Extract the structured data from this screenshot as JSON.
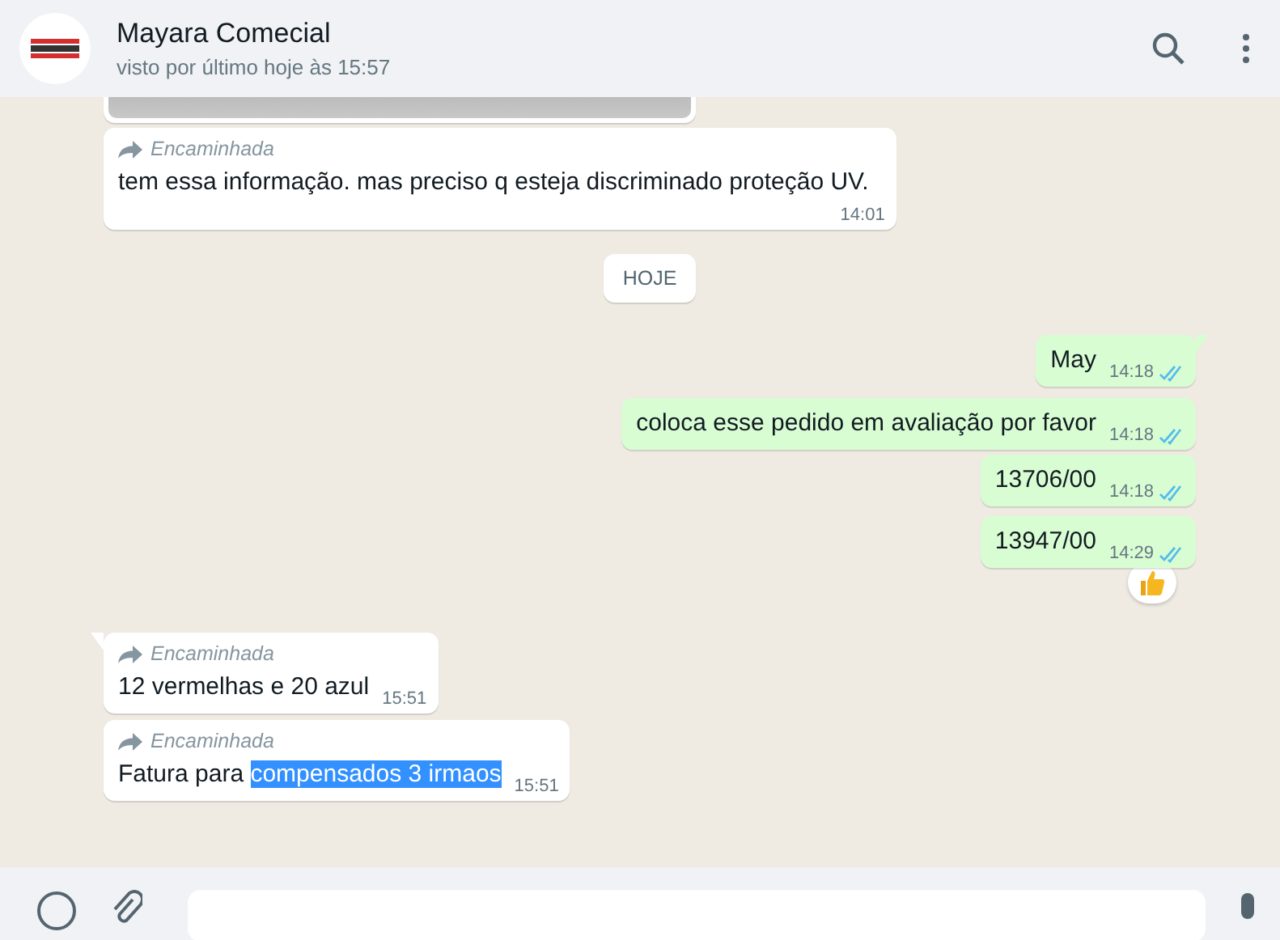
{
  "header": {
    "name": "Mayara Comecial",
    "status": "visto por último hoje às 15:57"
  },
  "messages": [
    {
      "kind": "image"
    },
    {
      "kind": "incoming",
      "forwarded": "Encaminhada",
      "text": "tem essa informação. mas preciso q esteja discriminado proteção UV.",
      "time": "14:01",
      "tail": false,
      "block_time": true
    },
    {
      "kind": "date",
      "text": "HOJE"
    },
    {
      "kind": "outgoing",
      "text": "May",
      "time": "14:18",
      "read": true,
      "tail": true
    },
    {
      "kind": "outgoing",
      "text": "coloca esse pedido em avaliação por favor",
      "time": "14:18",
      "read": true,
      "tail": false
    },
    {
      "kind": "outgoing",
      "text": "13706/00",
      "time": "14:18",
      "read": true,
      "tail": false
    },
    {
      "kind": "outgoing",
      "text": "13947/00",
      "time": "14:29",
      "read": true,
      "tail": false,
      "reaction": true
    },
    {
      "kind": "incoming",
      "forwarded": "Encaminhada",
      "text": "12 vermelhas e 20 azul",
      "time": "15:51",
      "tail": true
    },
    {
      "kind": "incoming",
      "forwarded": "Encaminhada",
      "text": "Fatura para ",
      "highlight": "compensados 3 irmaos",
      "time": "15:51",
      "tail": false
    }
  ]
}
